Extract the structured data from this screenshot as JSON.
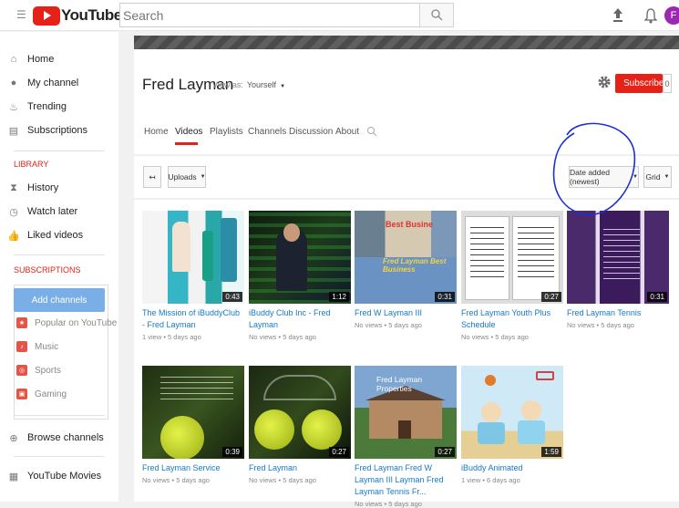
{
  "header": {
    "logo_text": "YouTube",
    "logo_region": "IN",
    "search_placeholder": "Search",
    "avatar_letter": "F"
  },
  "sidebar": {
    "items": [
      {
        "label": "Home",
        "icon": "home-icon"
      },
      {
        "label": "My channel",
        "icon": "person-icon"
      },
      {
        "label": "Trending",
        "icon": "flame-icon"
      },
      {
        "label": "Subscriptions",
        "icon": "subscriptions-icon"
      }
    ],
    "library_heading": "LIBRARY",
    "library": [
      {
        "label": "History",
        "icon": "hourglass-icon"
      },
      {
        "label": "Watch later",
        "icon": "clock-icon"
      },
      {
        "label": "Liked videos",
        "icon": "thumbs-up-icon"
      }
    ],
    "subscriptions_heading": "SUBSCRIPTIONS",
    "add_channels": "Add channels",
    "subs": [
      {
        "label": "Popular on YouTube",
        "color": "#e2564a"
      },
      {
        "label": "Music",
        "color": "#e2564a"
      },
      {
        "label": "Sports",
        "color": "#e2564a"
      },
      {
        "label": "Gaming",
        "color": "#e2564a"
      }
    ],
    "browse_channels": "Browse channels",
    "youtube_movies": "YouTube Movies"
  },
  "channel": {
    "name": "Fred Layman",
    "view_as_label": "View as:",
    "view_as_value": "Yourself",
    "subscribe_label": "Subscribe",
    "subscriber_count": "0",
    "tabs": [
      "Home",
      "Videos",
      "Playlists",
      "Channels",
      "Discussion",
      "About"
    ],
    "active_tab": "Videos"
  },
  "controls": {
    "uploads_label": "Uploads",
    "sort_label": "Date added (newest)",
    "view_label": "Grid"
  },
  "videos": [
    {
      "title": "The Mission of iBuddyClub - Fred Layman",
      "meta": "1 view • 5 days ago",
      "duration": "0:43"
    },
    {
      "title": "iBuddy Club Inc - Fred Layman",
      "meta": "No views • 5 days ago",
      "duration": "1:12"
    },
    {
      "title": "Fred W Layman III",
      "meta": "No views • 5 days ago",
      "duration": "0:31"
    },
    {
      "title": "Fred Layman Youth Plus Schedule",
      "meta": "No views • 5 days ago",
      "duration": "0:27"
    },
    {
      "title": "Fred Layman Tennis",
      "meta": "No views • 5 days ago",
      "duration": "0:31"
    },
    {
      "title": "Fred Layman Service",
      "meta": "No views • 5 days ago",
      "duration": "0:39"
    },
    {
      "title": "Fred Layman",
      "meta": "No views • 5 days ago",
      "duration": "0:27"
    },
    {
      "title": "Fred Layman Fred W Layman III Layman Fred Layman Tennis Fr...",
      "meta": "No views • 5 days ago",
      "duration": "0:27"
    },
    {
      "title": "iBuddy Animated",
      "meta": "1 view • 6 days ago",
      "duration": "1:59"
    }
  ],
  "thumb_texts": {
    "t3_banner": "Best Busine",
    "t3_overlay": "Fred Layman Best Business",
    "t8_overlay": "Fred Layman Properties"
  }
}
